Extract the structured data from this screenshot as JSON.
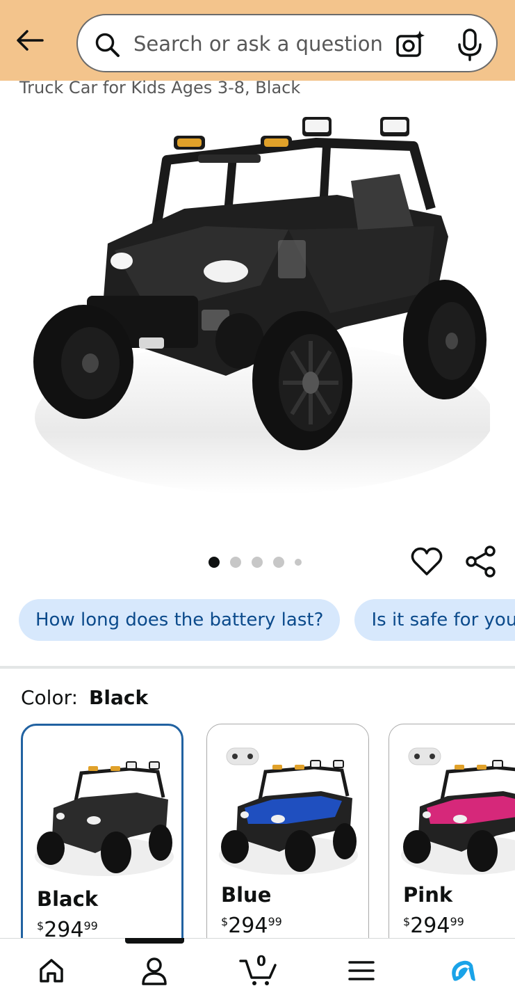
{
  "header": {
    "search": {
      "placeholder": "Search or ask a question",
      "value": ""
    },
    "background_color": "#f3c48c"
  },
  "product": {
    "title_fragment": "Truck Car for Kids Ages 3-8, Black",
    "image_pagination": {
      "total": 5,
      "current": 1
    }
  },
  "ask_chips": [
    {
      "label": "How long does the battery last?"
    },
    {
      "label": "Is it safe for young children?"
    }
  ],
  "color_selector": {
    "label": "Color:",
    "selected": "Black",
    "options": [
      {
        "name": "Black",
        "price_whole": "294",
        "price_fraction": "99",
        "currency": "$",
        "selected": true,
        "body_color": "#2b2b2b",
        "has_remote": false
      },
      {
        "name": "Blue",
        "price_whole": "294",
        "price_fraction": "99",
        "currency": "$",
        "selected": false,
        "body_color": "#1f4fbf",
        "has_remote": true
      },
      {
        "name": "Pink",
        "price_whole": "294",
        "price_fraction": "99",
        "currency": "$",
        "selected": false,
        "body_color": "#d6287a",
        "has_remote": true
      }
    ]
  },
  "bottom_nav": {
    "items": [
      "home-icon",
      "account-icon",
      "cart-icon",
      "menu-icon",
      "rufus-icon"
    ],
    "cart_count": "0"
  },
  "colors": {
    "chip_bg": "#d7e8fc",
    "chip_text": "#0b4a8b",
    "selected_border": "#2162a1",
    "rufus_accent": "#1aa3e8"
  }
}
